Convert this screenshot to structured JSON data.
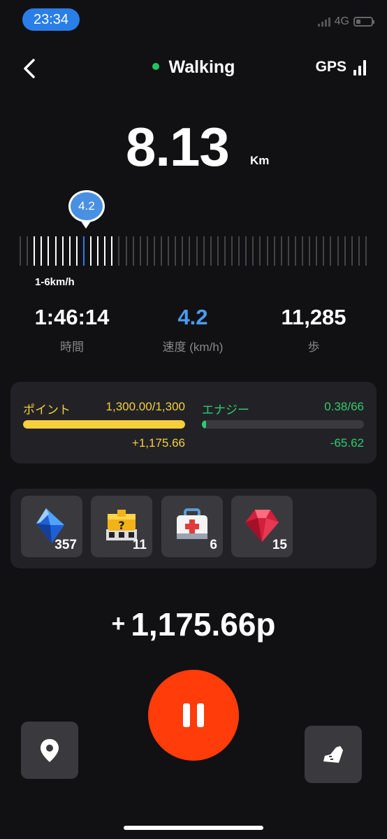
{
  "status_bar": {
    "time": "23:34",
    "network": "4G"
  },
  "header": {
    "mode": "Walking",
    "gps_label": "GPS"
  },
  "distance": {
    "value": "8.13",
    "unit": "Km"
  },
  "speed_scale": {
    "current": "4.2",
    "range_label": "1-6km/h"
  },
  "stats": [
    {
      "value": "1:46:14",
      "label": "時間"
    },
    {
      "value": "4.2",
      "label": "速度 (km/h)"
    },
    {
      "value": "11,285",
      "label": "歩"
    }
  ],
  "points": {
    "title": "ポイント",
    "value": "1,300.00/1,300",
    "delta": "+1,175.66",
    "fill": 1.0
  },
  "energy": {
    "title": "エナジー",
    "value": "0.38/66",
    "delta": "-65.62",
    "fill": 0.0058
  },
  "items": [
    {
      "icon": "blue-crystal-icon",
      "count": "357"
    },
    {
      "icon": "mystery-box-icon",
      "count": "11"
    },
    {
      "icon": "first-aid-kit-icon",
      "count": "6"
    },
    {
      "icon": "red-gem-icon",
      "count": "15"
    }
  ],
  "total": {
    "plus": "+",
    "value": "1,175.66p"
  },
  "colors": {
    "accent_blue": "#4a9cf2",
    "point_yellow": "#f5cf3c",
    "energy_green": "#2ecc71",
    "pause_red": "#ff3c0a"
  }
}
